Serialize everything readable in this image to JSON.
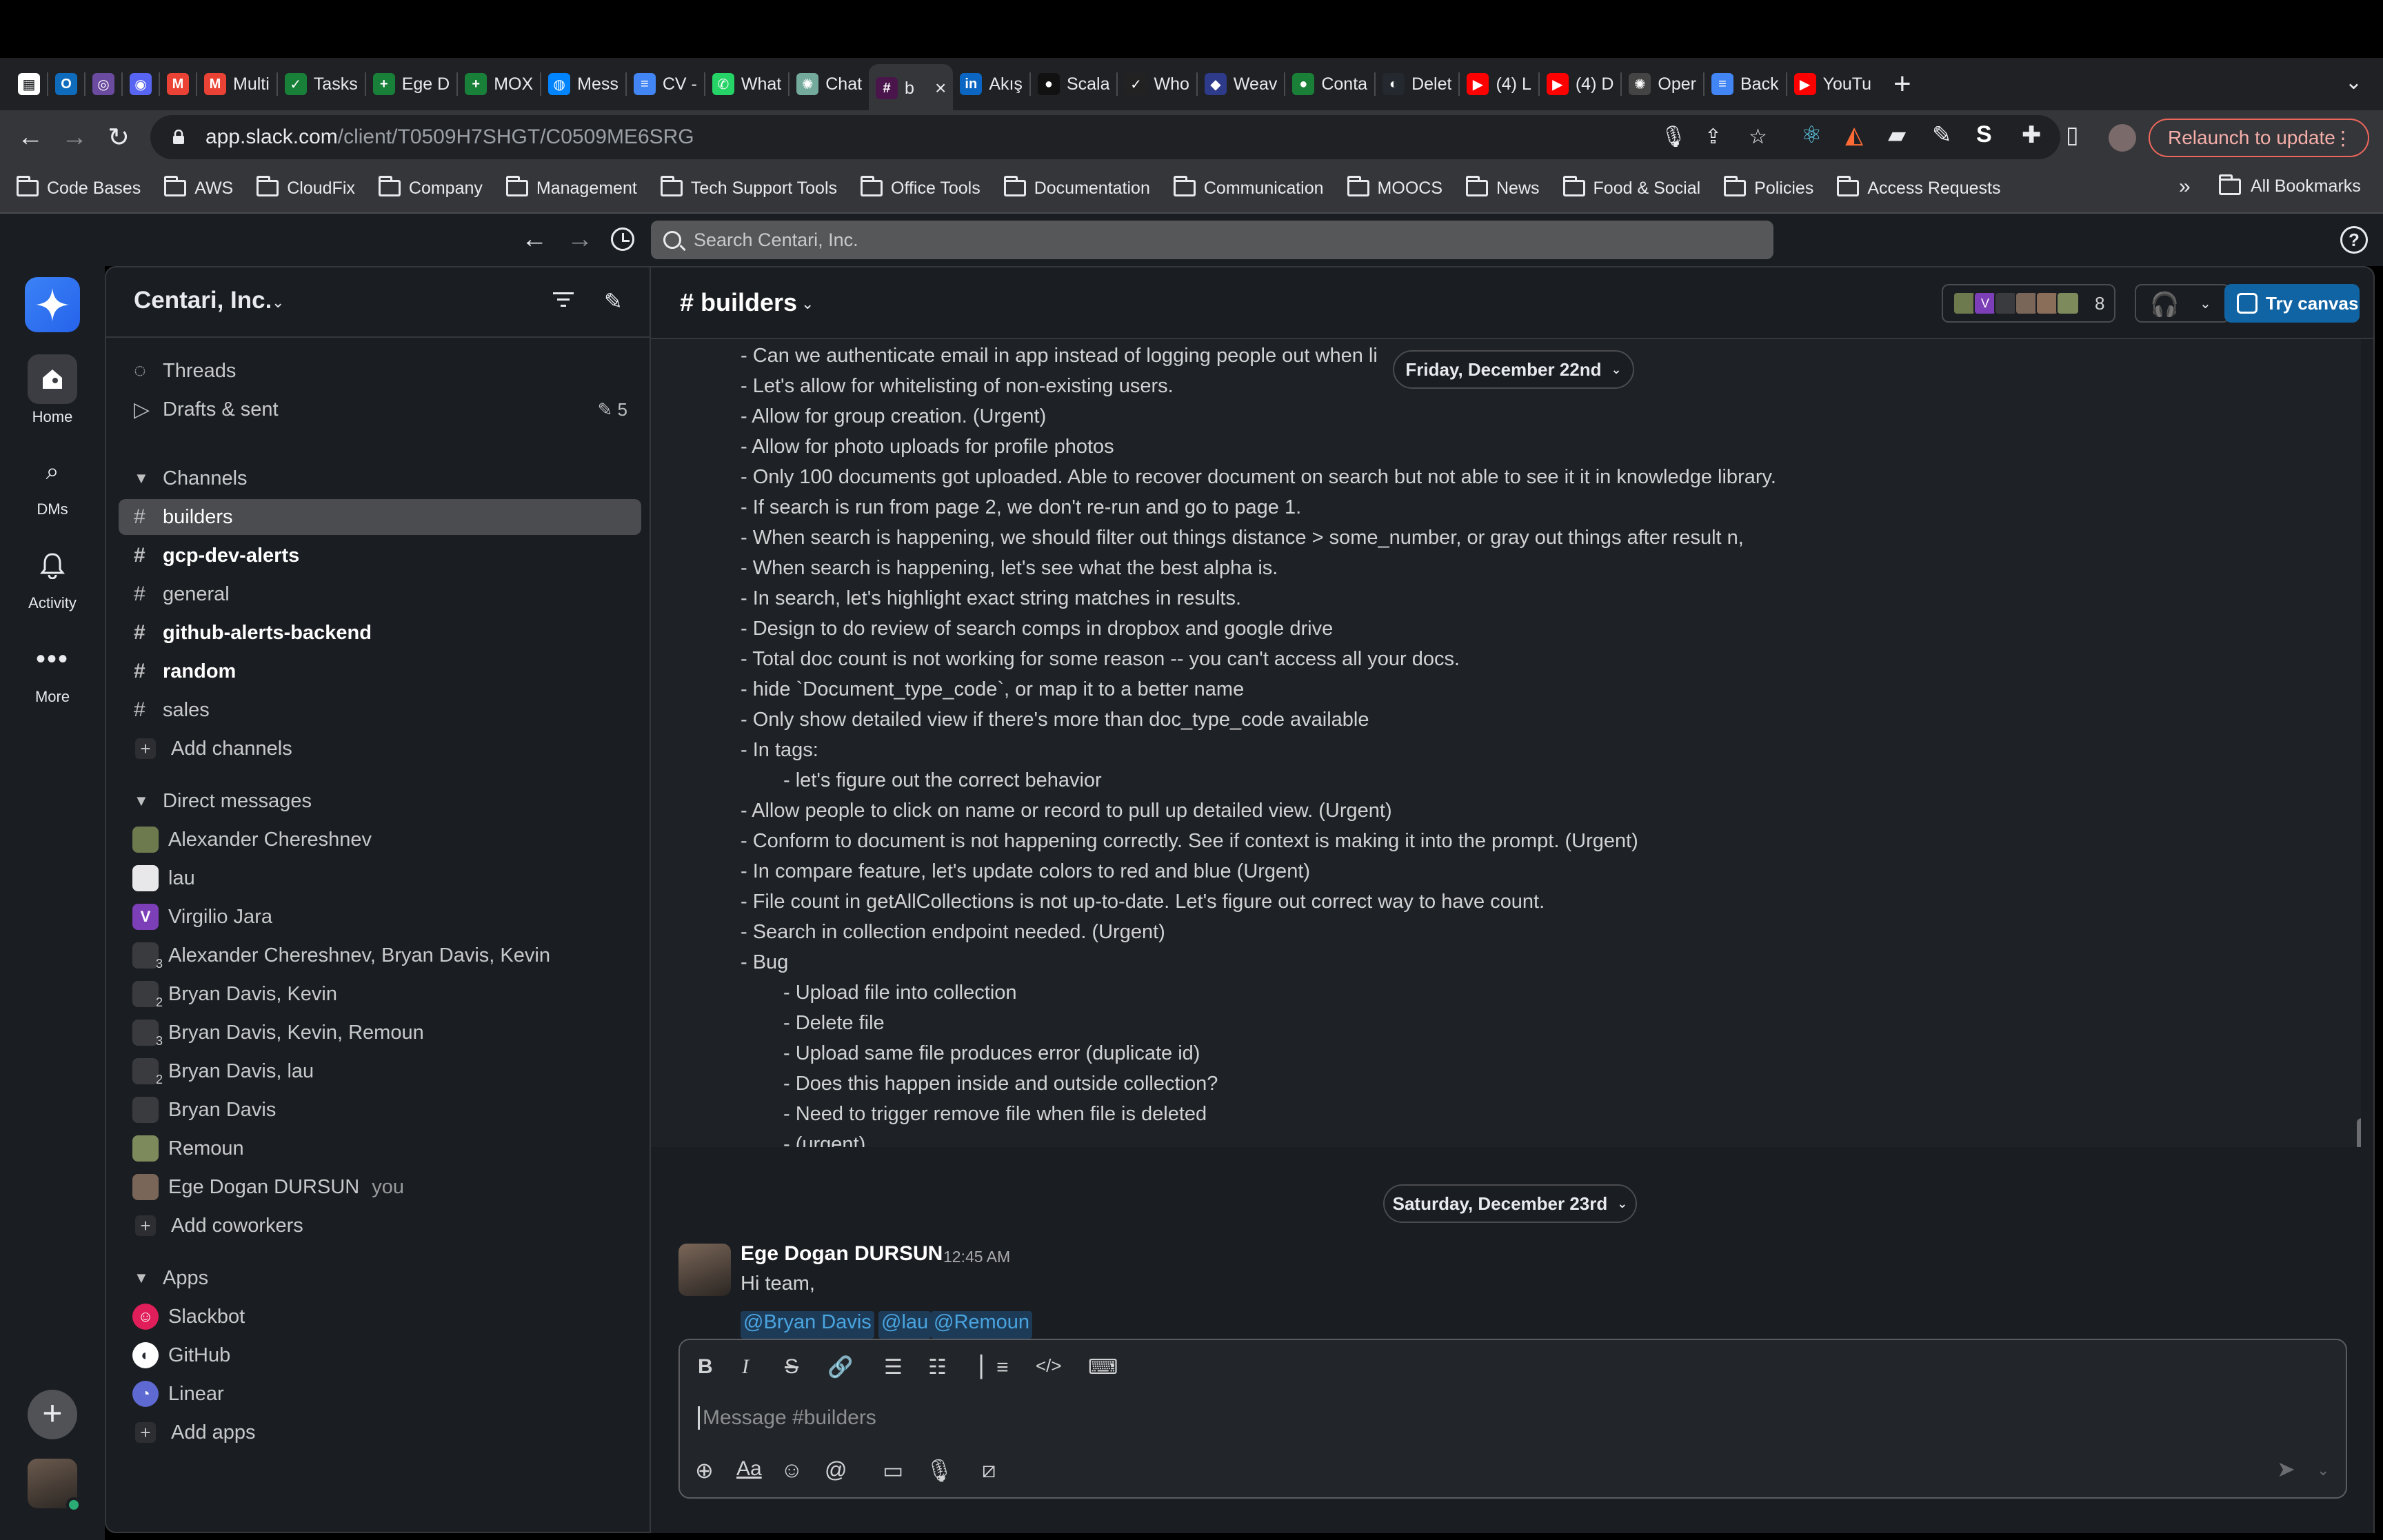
{
  "browser": {
    "tabs": [
      {
        "label": "",
        "color": "#ffffff",
        "glyph": "▦",
        "fg": "#202124"
      },
      {
        "label": "",
        "color": "#0f6cbd",
        "glyph": "O"
      },
      {
        "label": "",
        "color": "#6b4ba0",
        "glyph": "◎"
      },
      {
        "label": "",
        "color": "#5865f2",
        "glyph": "◉"
      },
      {
        "label": "",
        "color": "#ea4335",
        "glyph": "M"
      },
      {
        "label": "Multi",
        "color": "#ea4335",
        "glyph": "M"
      },
      {
        "label": "Tasks",
        "color": "#188038",
        "glyph": "✓"
      },
      {
        "label": "Ege D",
        "color": "#188038",
        "glyph": "+"
      },
      {
        "label": "MOX",
        "color": "#188038",
        "glyph": "+"
      },
      {
        "label": "Mess",
        "color": "#0084ff",
        "glyph": "◍"
      },
      {
        "label": "CV -",
        "color": "#4285f4",
        "glyph": "≡"
      },
      {
        "label": "What",
        "color": "#25d366",
        "glyph": "✆"
      },
      {
        "label": "Chat",
        "color": "#74aa9c",
        "glyph": "✺"
      },
      {
        "label": "b",
        "color": "#4a154b",
        "glyph": "#",
        "active": true
      },
      {
        "label": "Akış",
        "color": "#0a66c2",
        "glyph": "in"
      },
      {
        "label": "Scala",
        "color": "#111111",
        "glyph": "●"
      },
      {
        "label": "Who",
        "color": "#222222",
        "glyph": "✓"
      },
      {
        "label": "Weav",
        "color": "#2d3b8a",
        "glyph": "◆"
      },
      {
        "label": "Conta",
        "color": "#1a7f37",
        "glyph": "●"
      },
      {
        "label": "Delet",
        "color": "#24292f",
        "glyph": "◐"
      },
      {
        "label": "(4) L",
        "color": "#ff0000",
        "glyph": "▶"
      },
      {
        "label": "(4) D",
        "color": "#ff0000",
        "glyph": "▶"
      },
      {
        "label": "Oper",
        "color": "#444444",
        "glyph": "✺"
      },
      {
        "label": "Back",
        "color": "#4285f4",
        "glyph": "≡"
      },
      {
        "label": "YouTu",
        "color": "#ff0000",
        "glyph": "▶"
      }
    ],
    "tab_close": "×",
    "new_tab": "+",
    "url_host": "app.slack.com",
    "url_path": "/client/T0509H7SHGT/C0509ME6SRG",
    "relaunch_label": "Relaunch to update",
    "bookmarks": [
      "Code Bases",
      "AWS",
      "CloudFix",
      "Company",
      "Management",
      "Tech Support Tools",
      "Office Tools",
      "Documentation",
      "Communication",
      "MOOCS",
      "News",
      "Food & Social",
      "Policies",
      "Access Requests"
    ],
    "bookmarks_overflow": "»",
    "all_bookmarks": "All Bookmarks"
  },
  "slack": {
    "search_placeholder": "Search Centari, Inc.",
    "rail": {
      "home": "Home",
      "dms": "DMs",
      "activity": "Activity",
      "more": "More"
    },
    "workspace_name": "Centari, Inc.",
    "sidebar": {
      "threads": "Threads",
      "drafts": "Drafts & sent",
      "drafts_count": "5",
      "channels_header": "Channels",
      "channels": [
        {
          "name": "builders",
          "bold": false,
          "active": true
        },
        {
          "name": "gcp-dev-alerts",
          "bold": true
        },
        {
          "name": "general",
          "bold": false
        },
        {
          "name": "github-alerts-backend",
          "bold": true
        },
        {
          "name": "random",
          "bold": true
        },
        {
          "name": "sales",
          "bold": false
        }
      ],
      "add_channels": "Add channels",
      "dm_header": "Direct messages",
      "dms": [
        {
          "name": "Alexander Chereshnev",
          "color": "#6d7a4e",
          "glyph": ""
        },
        {
          "name": "lau",
          "color": "#e8e8ea",
          "glyph": "",
          "fg": "#6b2d86"
        },
        {
          "name": "Virgilio Jara",
          "color": "#7c3fb8",
          "glyph": "V"
        },
        {
          "name": "Alexander Chereshnev, Bryan Davis, Kevin",
          "color": "#3a3b3e",
          "glyph": "",
          "n": "3"
        },
        {
          "name": "Bryan Davis, Kevin",
          "color": "#3a3b3e",
          "glyph": "",
          "n": "2"
        },
        {
          "name": "Bryan Davis, Kevin, Remoun",
          "color": "#3a3b3e",
          "glyph": "",
          "n": "3"
        },
        {
          "name": "Bryan Davis, lau",
          "color": "#3a3b3e",
          "glyph": "",
          "n": "2"
        },
        {
          "name": "Bryan Davis",
          "color": "#3a3b3e",
          "glyph": ""
        },
        {
          "name": "Remoun",
          "color": "#7d8a5c",
          "glyph": ""
        },
        {
          "name": "Ege Dogan DURSUN",
          "color": "#7a6658",
          "glyph": "",
          "you": "you"
        }
      ],
      "add_coworkers": "Add coworkers",
      "apps_header": "Apps",
      "apps": [
        {
          "name": "Slackbot",
          "color": "#e01e5a",
          "glyph": "☺"
        },
        {
          "name": "GitHub",
          "color": "#ffffff",
          "glyph": "◐",
          "fg": "#24292f"
        },
        {
          "name": "Linear",
          "color": "#5e6ad2",
          "glyph": "◔"
        }
      ],
      "add_apps": "Add apps"
    },
    "channel": {
      "name": "builders",
      "member_count": "8",
      "try_canvas": "Try canvas",
      "date_1": "Friday, December 22nd",
      "date_2": "Saturday, December 23rd",
      "lines": [
        {
          "text": "- Can we authenticate email in app instead of logging people out when li",
          "sub": false
        },
        {
          "text": "- Let's allow for whitelisting of non-existing users.",
          "sub": false
        },
        {
          "text": "- Allow for group creation. (Urgent)",
          "sub": false
        },
        {
          "text": "- Allow for photo uploads for profile photos",
          "sub": false
        },
        {
          "text": "- Only 100 documents got uploaded. Able to recover document on search but not able to see it it in knowledge library.",
          "sub": false
        },
        {
          "text": "- If search is run from page 2, we don't re-run and go to page 1.",
          "sub": false
        },
        {
          "text": "- When search is happening, we should filter out things distance > some_number, or gray out things after result n,",
          "sub": false
        },
        {
          "text": "- When search is happening, let's see what the best alpha is.",
          "sub": false
        },
        {
          "text": "- In search, let's highlight exact string matches in results.",
          "sub": false
        },
        {
          "text": "- Design to do review of search comps in dropbox and google drive",
          "sub": false
        },
        {
          "text": "- Total doc count is not working for some reason -- you can't access all your docs.",
          "sub": false
        },
        {
          "text": "- hide `Document_type_code`, or map it to a better name",
          "sub": false
        },
        {
          "text": "- Only show detailed view if there's more than doc_type_code available",
          "sub": false
        },
        {
          "text": "- In tags:",
          "sub": false
        },
        {
          "text": "- let's figure out the correct behavior",
          "sub": true
        },
        {
          "text": "- Allow people to click on name or record to pull up detailed view. (Urgent)",
          "sub": false
        },
        {
          "text": "- Conform to document is not happening correctly. See if context is making it into the prompt. (Urgent)",
          "sub": false
        },
        {
          "text": "- In compare feature, let's update colors to red and blue (Urgent)",
          "sub": false
        },
        {
          "text": "- File count in getAllCollections is not up-to-date. Let's figure out correct way to have count.",
          "sub": false
        },
        {
          "text": "- Search in collection endpoint needed. (Urgent)",
          "sub": false
        },
        {
          "text": "- Bug",
          "sub": false
        },
        {
          "text": "- Upload file into collection",
          "sub": true
        },
        {
          "text": "- Delete file",
          "sub": true
        },
        {
          "text": "- Upload same file produces error (duplicate id)",
          "sub": true
        },
        {
          "text": "- Does this happen inside and outside collection?",
          "sub": true
        },
        {
          "text": "- Need to trigger remove file when file is deleted",
          "sub": true
        },
        {
          "text": "- (urgent)",
          "sub": true
        }
      ],
      "message": {
        "author": "Ege Dogan DURSUN",
        "time": "12:45 AM",
        "text": "Hi team,",
        "mentions": [
          "@Bryan Davis",
          "@lau",
          "@Remoun"
        ]
      },
      "composer_placeholder": "Message #builders"
    }
  },
  "colors": {
    "accent": "#1164a3",
    "online": "#2bac76",
    "mention_bg": "#1d3b57"
  }
}
